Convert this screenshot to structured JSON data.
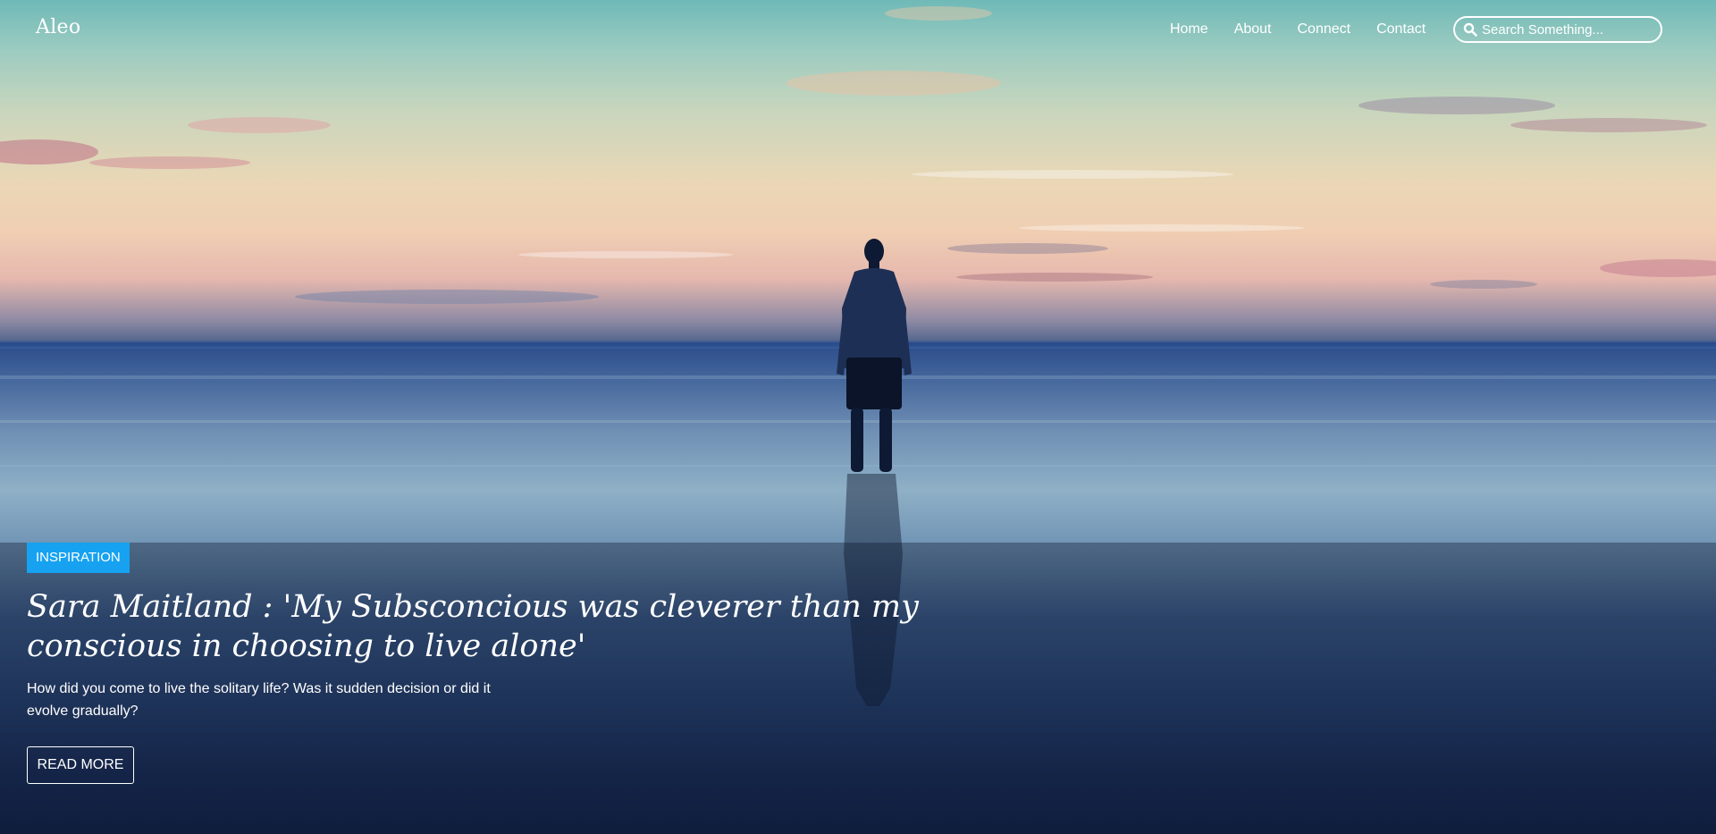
{
  "header": {
    "logo": "Aleo",
    "nav": [
      {
        "label": "Home"
      },
      {
        "label": "About"
      },
      {
        "label": "Connect"
      },
      {
        "label": "Contact"
      }
    ],
    "search": {
      "placeholder": "Search Something...",
      "value": "",
      "icon": "search-icon"
    }
  },
  "hero": {
    "image_subject": "person standing on beach at sunset",
    "category": "INSPIRATION",
    "title": "Sara Maitland : 'My Subsconcious was cleverer than my conscious in choosing to live alone'",
    "excerpt": "How did you come to live the solitary life? Was it sudden decision or did it evolve gradually?",
    "read_more": "READ MORE"
  },
  "colors": {
    "accent": "#16a2f0",
    "text": "#ffffff",
    "overlay": "rgba(8, 18, 38, 0.35)"
  }
}
